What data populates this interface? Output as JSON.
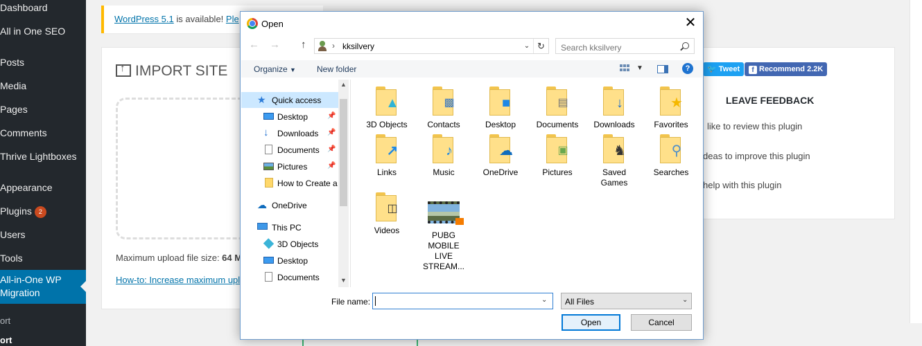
{
  "wp_sidebar": {
    "items": [
      {
        "label": "Dashboard"
      },
      {
        "label": "All in One SEO"
      },
      {
        "label": "Posts"
      },
      {
        "label": "Media"
      },
      {
        "label": "Pages"
      },
      {
        "label": "Comments"
      },
      {
        "label": "Thrive Lightboxes"
      },
      {
        "label": "Appearance"
      },
      {
        "label": "Plugins",
        "badge": "2"
      },
      {
        "label": "Users"
      },
      {
        "label": "Tools"
      },
      {
        "label": "All-in-One WP Migration"
      }
    ],
    "submenu": [
      {
        "label": "ort"
      },
      {
        "label": "ort"
      }
    ]
  },
  "notice": {
    "link": "WordPress 5.1",
    "text": " is available! ",
    "link2": "Ple"
  },
  "import_panel": {
    "title": "IMPORT SITE",
    "max_upload_prefix": "Maximum upload file size: ",
    "max_upload_value": "64 M",
    "howto_link": "How-to: Increase maximum upl"
  },
  "right_panel": {
    "tweet": "Tweet",
    "recommend": "Recommend 2.2K",
    "feedback_title": "LEAVE FEEDBACK",
    "options": [
      "like to review this plugin",
      "deas to improve this plugin",
      "help with this plugin"
    ]
  },
  "dialog": {
    "title": "Open",
    "close": "✕",
    "address_path": "kksilvery",
    "search_placeholder": "Search kksilvery",
    "organize": "Organize",
    "new_folder": "New folder",
    "help": "?",
    "nav": [
      {
        "label": "Quick access",
        "icon": "star-icon",
        "selected": true
      },
      {
        "label": "Desktop",
        "icon": "desktop-icon",
        "pinned": true
      },
      {
        "label": "Downloads",
        "icon": "downloads-icon",
        "pinned": true
      },
      {
        "label": "Documents",
        "icon": "documents-icon",
        "pinned": true
      },
      {
        "label": "Pictures",
        "icon": "pictures-icon",
        "pinned": true
      },
      {
        "label": "How to Create a",
        "icon": "folder-icon"
      },
      {
        "label": "OneDrive",
        "icon": "onedrive-cloud-icon"
      },
      {
        "label": "This PC",
        "icon": "computer-icon"
      },
      {
        "label": "3D Objects",
        "icon": "3d-objects-icon"
      },
      {
        "label": "Desktop",
        "icon": "desktop-icon"
      },
      {
        "label": "Documents",
        "icon": "documents-icon"
      }
    ],
    "files": [
      {
        "label": "3D Objects",
        "icon": "cube-icon"
      },
      {
        "label": "Contacts",
        "icon": "contact-card-icon"
      },
      {
        "label": "Desktop",
        "icon": "desktop-icon"
      },
      {
        "label": "Documents",
        "icon": "document-icon"
      },
      {
        "label": "Downloads",
        "icon": "download-arrow-icon"
      },
      {
        "label": "Favorites",
        "icon": "star-icon"
      },
      {
        "label": "Links",
        "icon": "link-arrow-icon"
      },
      {
        "label": "Music",
        "icon": "music-note-icon"
      },
      {
        "label": "OneDrive",
        "icon": "cloud-icon"
      },
      {
        "label": "Pictures",
        "icon": "picture-icon"
      },
      {
        "label": "Saved\nGames",
        "icon": "chess-piece-icon"
      },
      {
        "label": "Searches",
        "icon": "magnifier-icon"
      },
      {
        "label": "Videos",
        "icon": "film-icon"
      },
      {
        "label": "PUBG\nMOBILE\nLIVE\nSTREAM...",
        "icon": "video-file-icon"
      }
    ],
    "filename_label": "File name:",
    "filename_value": "",
    "filetype": "All Files",
    "open_btn": "Open",
    "cancel_btn": "Cancel"
  }
}
